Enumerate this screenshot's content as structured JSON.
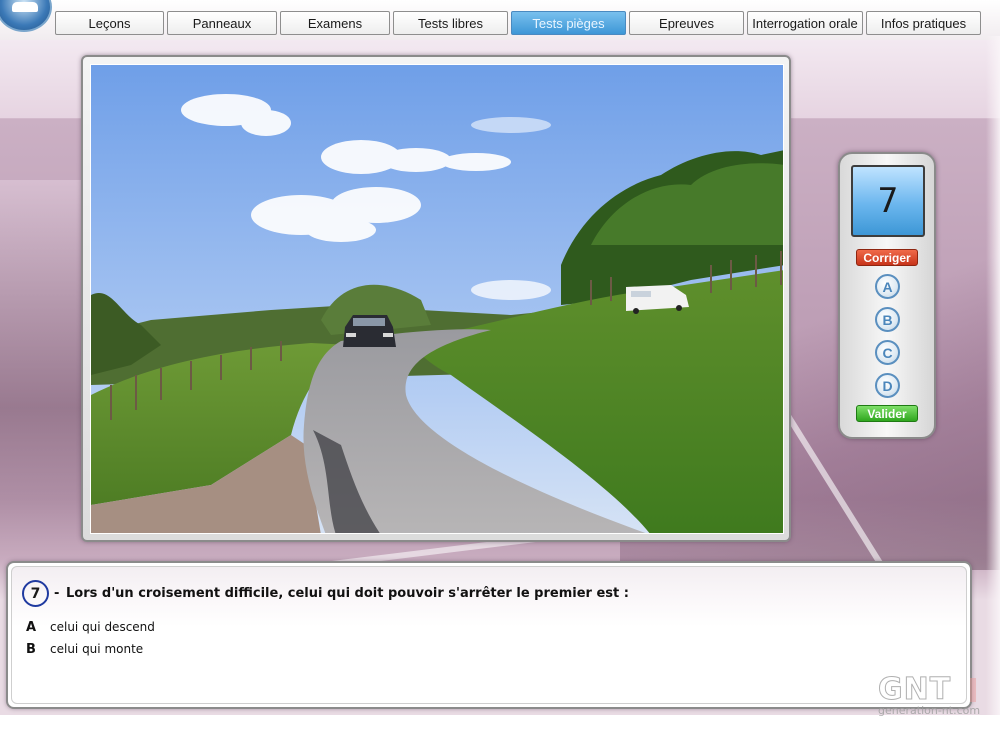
{
  "nav": {
    "tabs": [
      {
        "label": "Leçons",
        "active": false
      },
      {
        "label": "Panneaux",
        "active": false
      },
      {
        "label": "Examens",
        "active": false
      },
      {
        "label": "Tests libres",
        "active": false
      },
      {
        "label": "Tests pièges",
        "active": true
      },
      {
        "label": "Epreuves",
        "active": false
      },
      {
        "label": "Interrogation orale",
        "active": false
      },
      {
        "label": "Infos pratiques",
        "active": false
      }
    ]
  },
  "photo": {
    "scene": "country-road-crossing"
  },
  "answer_panel": {
    "counter": "7",
    "corriger_label": "Corriger",
    "choices": [
      "A",
      "B",
      "C",
      "D"
    ],
    "valider_label": "Valider"
  },
  "question": {
    "number": "7",
    "dash": "-",
    "text": "Lors d'un croisement difficile, celui qui doit pouvoir s'arrêter le premier est :",
    "answers": [
      {
        "letter": "A",
        "text": "celui qui descend"
      },
      {
        "letter": "B",
        "text": "celui qui monte"
      }
    ]
  },
  "watermark": {
    "logo": "GNT",
    "url": "generation-nt.com"
  },
  "colors": {
    "active_tab": "#3d97d6",
    "corriger": "#c7341a",
    "valider": "#2fa61f",
    "choice_ring": "#5a8fbf",
    "question_number_ring": "#1f3aa0"
  }
}
